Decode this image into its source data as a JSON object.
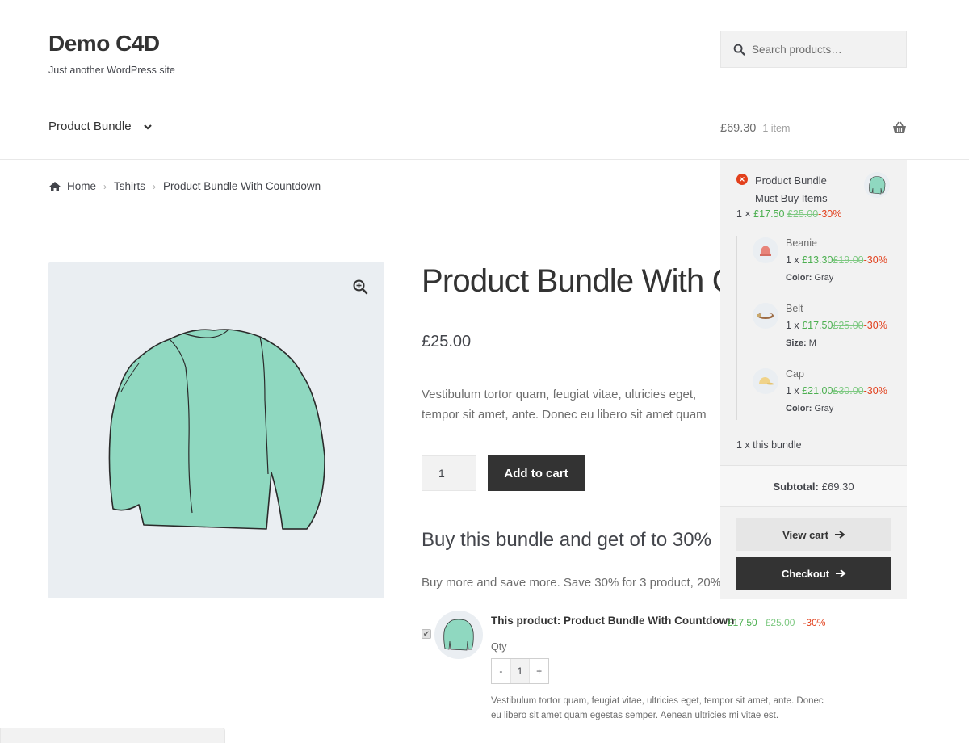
{
  "site": {
    "title": "Demo C4D",
    "tagline": "Just another WordPress site"
  },
  "search": {
    "placeholder": "Search products…",
    "icon": "search-icon"
  },
  "nav": {
    "item_label": "Product Bundle",
    "chevron_icon": "chevron-down-icon"
  },
  "cart": {
    "amount": "£69.30",
    "count": "1 item",
    "icon": "basket-icon"
  },
  "breadcrumb": {
    "items": [
      "Home",
      "Tshirts",
      "Product Bundle With Countdown"
    ]
  },
  "product": {
    "title": "Product Bundle With Countdown",
    "price": "£25.00",
    "description": "Vestibulum tortor quam, feugiat vitae, ultricies eget, tempor sit amet, ante. Donec eu libero sit amet quam egestas semper. Aenean ultricies mi vitae est.",
    "qty": "1",
    "add_to_cart_label": "Add to cart"
  },
  "bundle": {
    "heading": "Buy this bundle and get of to 30%",
    "subheading": "Buy more and save more. Save 30% for 3 product, 20% for 2 products.",
    "item": {
      "name": "This product: Product Bundle With Countdown",
      "price": "£17.50",
      "regular_price": "£25.00",
      "discount": "-30%",
      "qty_label": "Qty",
      "qty": "1",
      "minus": "-",
      "plus": "+",
      "description": "Vestibulum tortor quam, feugiat vitae, ultricies eget, tempor sit amet, ante. Donec eu libero sit amet quam egestas semper. Aenean ultricies mi vitae est."
    }
  },
  "minicart": {
    "product": {
      "name_line1": "Product Bundle",
      "name_line2": "Must Buy Items",
      "qty_prefix": "1 ×",
      "price": "£17.50",
      "regular_price": "£25.00",
      "discount": "-30%"
    },
    "items": [
      {
        "name": "Beanie",
        "qty_prefix": "1 x",
        "price": "£13.30",
        "regular_price": "£19.00",
        "discount": "-30%",
        "attr_label": "Color:",
        "attr_value": "Gray"
      },
      {
        "name": "Belt",
        "qty_prefix": "1 x",
        "price": "£17.50",
        "regular_price": "£25.00",
        "discount": "-30%",
        "attr_label": "Size:",
        "attr_value": "M"
      },
      {
        "name": "Cap",
        "qty_prefix": "1 x",
        "price": "£21.00",
        "regular_price": "£30.00",
        "discount": "-30%",
        "attr_label": "Color:",
        "attr_value": "Gray"
      }
    ],
    "bundle_qty": "1 x this bundle",
    "subtotal_label": "Subtotal:",
    "subtotal_value": "£69.30",
    "view_cart_label": "View cart",
    "checkout_label": "Checkout"
  },
  "colors": {
    "sale_green": "#4caf50",
    "discount_red": "#e2401c",
    "dark_button": "#333333",
    "sweater_mint": "#8fd8c0"
  }
}
